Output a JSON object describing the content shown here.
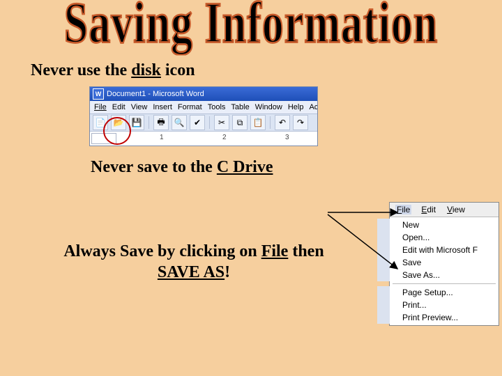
{
  "title": "Saving Information",
  "lines": {
    "l1_pre": "Never use the ",
    "l1_u": "disk",
    "l1_post": " icon",
    "l2_pre": "Never save to the ",
    "l2_u": "C Drive",
    "l3_pre": "Always Save by clicking on ",
    "l3_u1": "File",
    "l3_mid": " then ",
    "l3_u2": "SAVE AS",
    "l3_post": "!"
  },
  "word": {
    "doc_title": "Document1 - Microsoft Word",
    "menu": {
      "file": "File",
      "edit": "Edit",
      "view": "View",
      "insert": "Insert",
      "format": "Format",
      "tools": "Tools",
      "table": "Table",
      "window": "Window",
      "help": "Help",
      "acrobat": "Acrobat"
    },
    "ruler": {
      "m1": "1",
      "m2": "2",
      "m3": "3"
    }
  },
  "filemenu": {
    "bar": {
      "file": "File",
      "edit": "Edit",
      "view": "View"
    },
    "items": {
      "new": "New",
      "open": "Open...",
      "editms": "Edit with Microsoft F",
      "save": "Save",
      "saveas": "Save As...",
      "pagesetup": "Page Setup...",
      "print": "Print...",
      "preview": "Print Preview..."
    }
  }
}
